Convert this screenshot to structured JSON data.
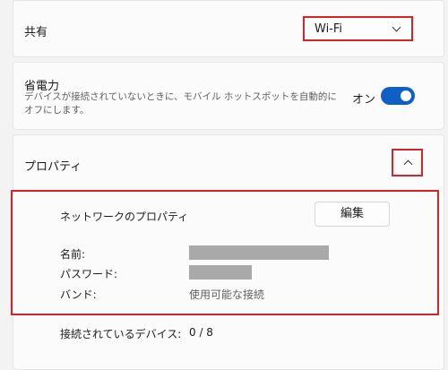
{
  "sharing": {
    "label": "共有",
    "selected": "Wi-Fi"
  },
  "power_saving": {
    "title": "省電力",
    "description": "デバイスが接続されていないときに、モバイル ホットスポットを自動的にオフにします。",
    "toggle_state": "オン"
  },
  "properties": {
    "title": "プロパティ",
    "network_properties_label": "ネットワークのプロパティ",
    "edit_button": "編集",
    "name_label": "名前:",
    "password_label": "パスワード:",
    "band_label": "バンド:",
    "band_value": "使用可能な接続",
    "connected_devices_label": "接続されているデバイス:",
    "connected_devices_value": "0 / 8"
  }
}
